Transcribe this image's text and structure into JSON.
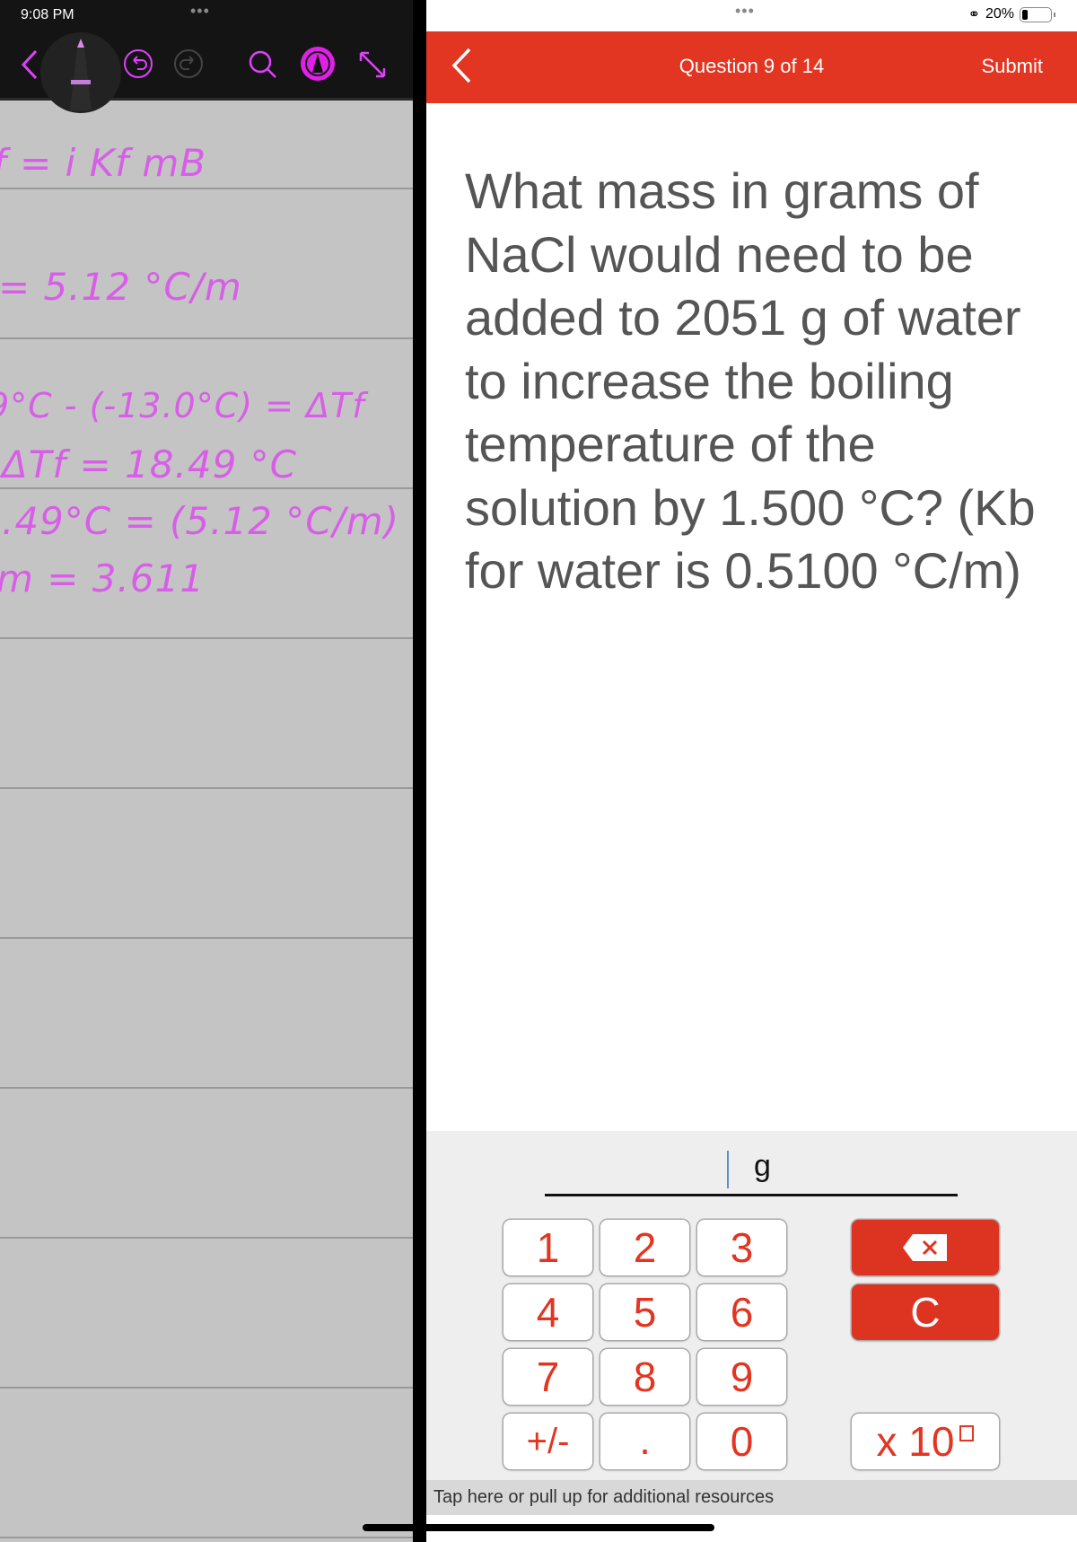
{
  "left_app": {
    "status_time": "9:08 PM",
    "toolbar": {
      "icons": [
        "chevron-left-icon",
        "pencil-tool-icon",
        "undo-icon",
        "redo-icon",
        "search-icon",
        "markup-pen-icon",
        "expand-icon"
      ]
    },
    "notes": [
      "f = i Kf mB",
      "= 5.12 °C/m",
      "9°C - (-13.0°C) = ΔTf",
      "ΔTf = 18.49 °C",
      ".49°C = (5.12 °C/m)",
      "m = 3.611"
    ],
    "accent": "#e040fb"
  },
  "right_app": {
    "battery": "20%",
    "header": {
      "title": "Question 9 of 14",
      "submit": "Submit",
      "color": "#e23522"
    },
    "question": "What mass in grams of NaCl would need to be added to 2051 g of water to increase the boiling temperature of the solution by 1.500 °C? (Kb for water is 0.5100 °C/m)",
    "answer": {
      "value": "",
      "unit": "g"
    },
    "keypad": {
      "keys": [
        "1",
        "2",
        "3",
        "4",
        "5",
        "6",
        "7",
        "8",
        "9",
        "+/-",
        ".",
        "0"
      ],
      "clear": "C",
      "sci": "x 10"
    },
    "resources": "Tap here or pull up for additional resources"
  }
}
